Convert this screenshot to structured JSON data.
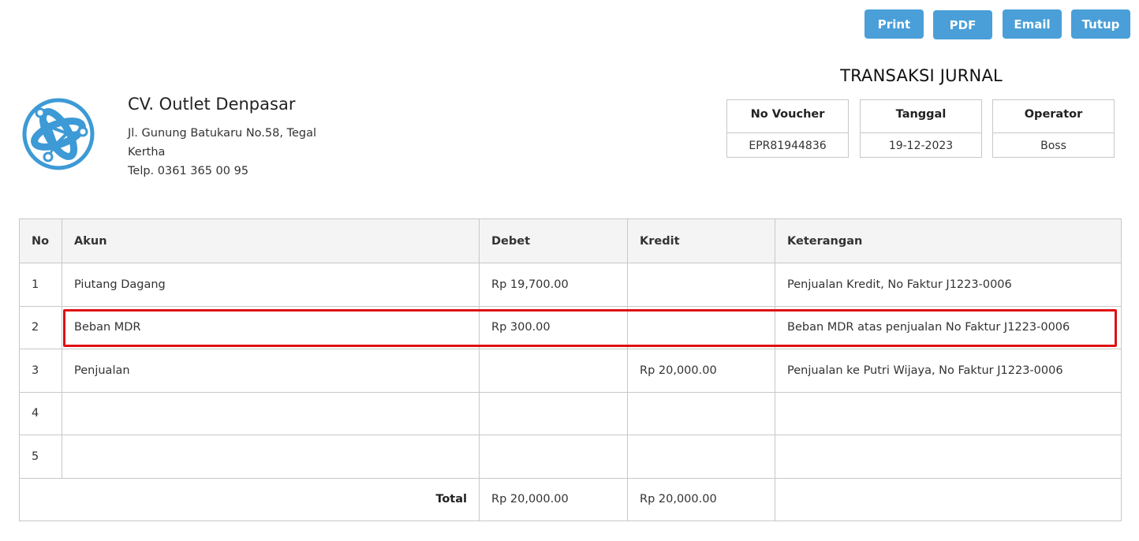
{
  "toolbar": {
    "print_label": "Print",
    "pdf_label": "PDF",
    "email_label": "Email",
    "close_label": "Tutup"
  },
  "company": {
    "name": "CV. Outlet Denpasar",
    "address": "Jl. Gunung Batukaru No.58, Tegal Kertha",
    "phone": "Telp. 0361 365 00 95",
    "logo_icon": "atom-logo-icon",
    "logo_color": "#3d9ad6"
  },
  "document": {
    "title": "TRANSAKSI JURNAL",
    "voucher_label": "No Voucher",
    "voucher_value": "EPR81944836",
    "date_label": "Tanggal",
    "date_value": "19-12-2023",
    "operator_label": "Operator",
    "operator_value": "Boss"
  },
  "table": {
    "headers": {
      "no": "No",
      "akun": "Akun",
      "debet": "Debet",
      "kredit": "Kredit",
      "keterangan": "Keterangan"
    },
    "rows": [
      {
        "no": "1",
        "akun": "Piutang Dagang",
        "debet": "Rp 19,700.00",
        "kredit": "",
        "keterangan": "Penjualan Kredit, No Faktur J1223-0006"
      },
      {
        "no": "2",
        "akun": "Beban MDR",
        "debet": "Rp 300.00",
        "kredit": "",
        "keterangan": "Beban MDR atas penjualan No Faktur J1223-0006"
      },
      {
        "no": "3",
        "akun": "Penjualan",
        "debet": "",
        "kredit": "Rp 20,000.00",
        "keterangan": "Penjualan ke Putri Wijaya, No Faktur J1223-0006"
      },
      {
        "no": "4",
        "akun": "",
        "debet": "",
        "kredit": "",
        "keterangan": ""
      },
      {
        "no": "5",
        "akun": "",
        "debet": "",
        "kredit": "",
        "keterangan": ""
      }
    ],
    "total": {
      "label": "Total",
      "debet": "Rp 20,000.00",
      "kredit": "Rp 20,000.00",
      "keterangan": ""
    }
  },
  "colors": {
    "button": "#4a9fd8",
    "highlight": "#e01010",
    "header_bg": "#f4f4f4",
    "border": "#c8c8c8"
  }
}
